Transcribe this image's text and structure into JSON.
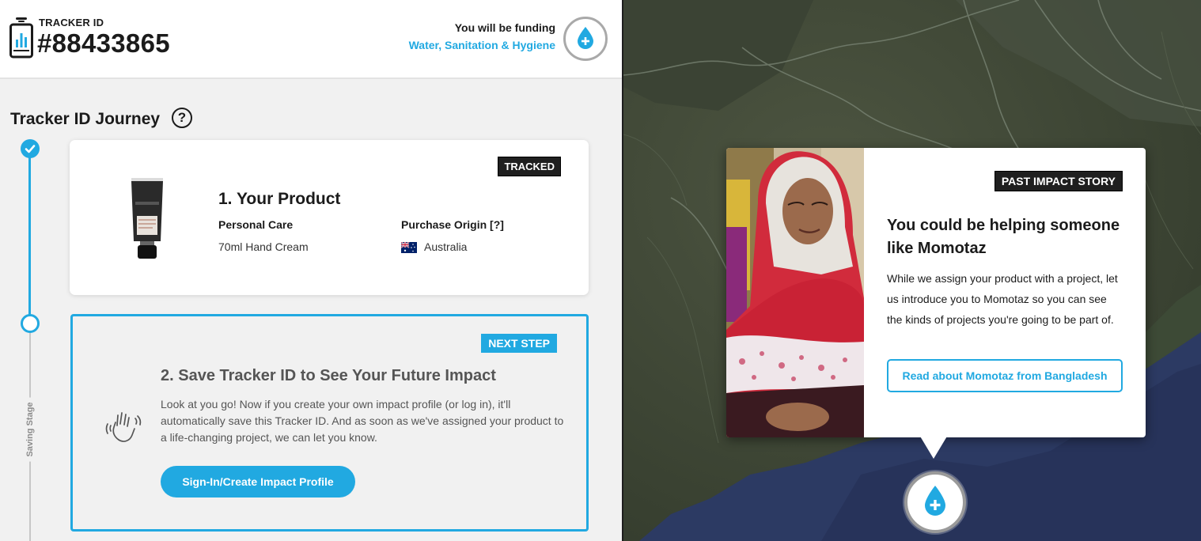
{
  "header": {
    "tracker_label": "TRACKER ID",
    "tracker_number": "#88433865",
    "funding_line": "You will be funding",
    "funding_cause": "Water, Sanitation & Hygiene"
  },
  "journey": {
    "title": "Tracker ID Journey",
    "help_symbol": "?",
    "stage_label": "Saving Stage"
  },
  "product_card": {
    "badge": "TRACKED",
    "title": "1. Your Product",
    "category_label": "Personal Care",
    "category_value": "70ml Hand Cream",
    "origin_label": "Purchase Origin [?]",
    "origin_value": "Australia",
    "product_brand": "thankyou.",
    "product_name": "HAND CREAM"
  },
  "next_step_card": {
    "badge": "NEXT STEP",
    "title": "2. Save Tracker ID to See Your Future Impact",
    "text": "Look at you go! Now if you create your own impact profile (or log in), it'll automatically save this Tracker ID. And as soon as we've assigned your product to a life-changing project, we can let you know.",
    "button_label": "Sign-In/Create Impact Profile"
  },
  "story_card": {
    "badge": "PAST IMPACT STORY",
    "title": "You could be helping someone like Momotaz",
    "text": "While we assign your product with a project, let us introduce you to Momotaz so you can see the kinds of projects you're going to be part of.",
    "button_label": "Read about Momotaz from Bangladesh"
  },
  "icons": {
    "phone": "tracker-phone-icon",
    "cause": "water-drop-plus-icon",
    "help": "question-icon",
    "step_done": "check-icon",
    "wave": "waving-hand-icon",
    "pin": "water-drop-plus-icon"
  },
  "colors": {
    "accent": "#21a9e1",
    "dark_badge": "#1f1f1f",
    "panel_bg": "#f1f1f1",
    "ocean": "#2c3a63",
    "land": "#3f4a35"
  }
}
